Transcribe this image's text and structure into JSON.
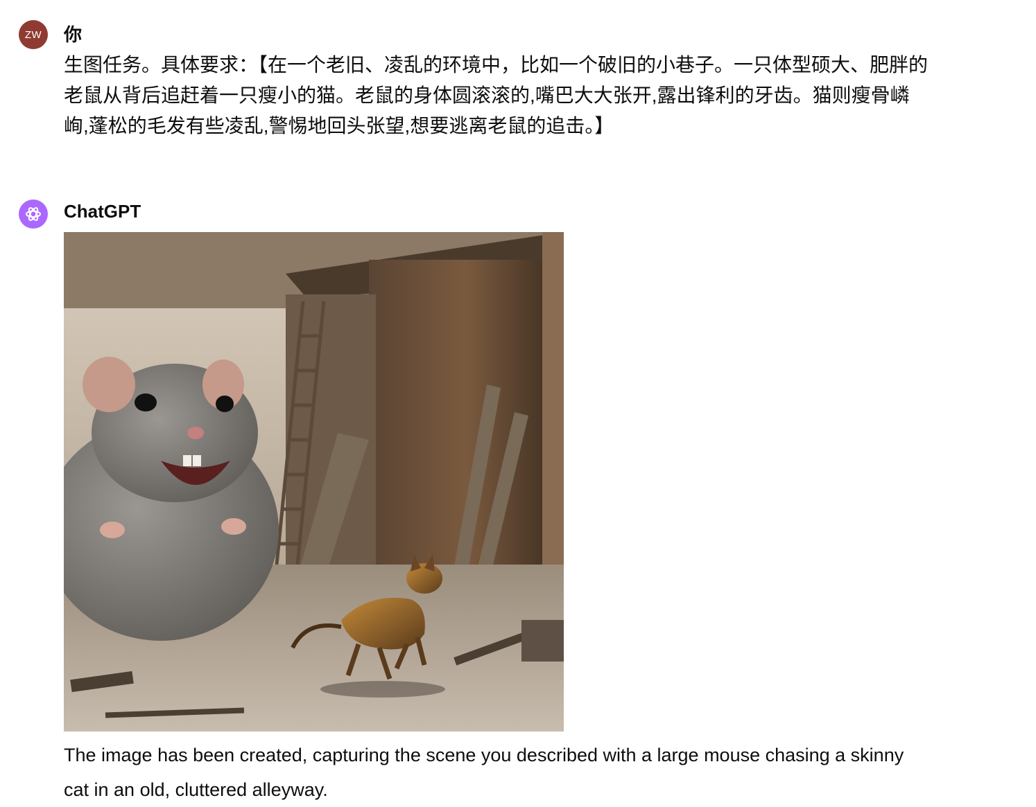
{
  "user_message": {
    "avatar_initials": "ZW",
    "author": "你",
    "text": "生图任务。具体要求：【在一个老旧、凌乱的环境中，比如一个破旧的小巷子。一只体型硕大、肥胖的老鼠从背后追赶着一只瘦小的猫。老鼠的身体圆滚滚的,嘴巴大大张开,露出锋利的牙齿。猫则瘦骨嶙峋,蓬松的毛发有些凌乱,警惕地回头张望,想要逃离老鼠的追击。】"
  },
  "assistant_message": {
    "avatar_icon": "openai-logo-icon",
    "author": "ChatGPT",
    "image_icon": "generated-image",
    "reply_text": "The image has been created, capturing the scene you described with a large mouse chasing a skinny cat in an old, cluttered alleyway."
  },
  "colors": {
    "user_avatar_bg": "#8f3b32",
    "assistant_avatar_bg": "#ab68ff",
    "text": "#0d0d0d"
  }
}
